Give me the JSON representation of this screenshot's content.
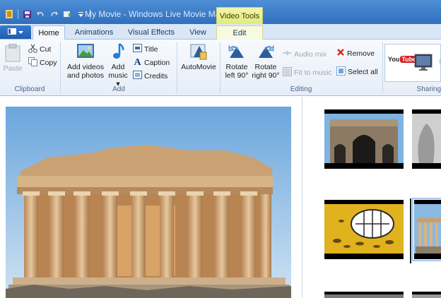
{
  "window": {
    "title": "My Movie - Windows Live Movie Maker",
    "context_tab_header": "Video Tools"
  },
  "quick_access": {
    "icons": [
      "app-icon",
      "save-icon",
      "undo-icon",
      "redo-icon",
      "dropdown-icon"
    ]
  },
  "tabs": {
    "file_menu_icon": "file-menu-icon",
    "items": [
      {
        "label": "Home",
        "active": true
      },
      {
        "label": "Animations",
        "active": false
      },
      {
        "label": "Visual Effects",
        "active": false
      },
      {
        "label": "View",
        "active": false
      },
      {
        "label": "Edit",
        "active": false
      }
    ]
  },
  "ribbon": {
    "clipboard": {
      "label": "Clipboard",
      "paste": "Paste",
      "cut": "Cut",
      "copy": "Copy"
    },
    "add": {
      "label": "Add",
      "add_videos_line1": "Add videos",
      "add_videos_line2": "and photos",
      "add_music_line1": "Add",
      "add_music_line2": "music",
      "title": "Title",
      "caption": "Caption",
      "credits": "Credits"
    },
    "automovie": {
      "label": "AutoMovie"
    },
    "editing": {
      "label": "Editing",
      "rotate_left_line1": "Rotate",
      "rotate_left_line2": "left 90°",
      "rotate_right_line1": "Rotate",
      "rotate_right_line2": "right 90°",
      "audio_mix": "Audio mix",
      "fit_to_music": "Fit to music",
      "remove": "Remove",
      "select_all": "Select all"
    },
    "sharing": {
      "label": "Sharing",
      "youtube": "You Tube"
    }
  },
  "colors": {
    "titlebar": "#2f6fbe",
    "context_tab": "#e2eb7c",
    "ribbon_bg": "#e6eef8",
    "sky": "#7fb3e0",
    "marble": "#c89a66"
  }
}
